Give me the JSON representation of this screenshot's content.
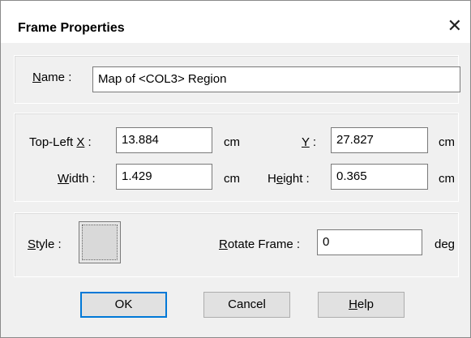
{
  "window": {
    "title": "Frame Properties",
    "close_icon": "close-icon"
  },
  "name_group": {
    "label_pre": "",
    "label_key": "N",
    "label_post": "ame :",
    "value": "Map of <COL3> Region"
  },
  "position_group": {
    "top_left_x": {
      "label_pre": "Top-Left ",
      "label_key": "X",
      "label_post": " :",
      "value": "13.884",
      "unit": "cm"
    },
    "y": {
      "label_pre": "",
      "label_key": "Y",
      "label_post": " :",
      "value": "27.827",
      "unit": "cm"
    },
    "width": {
      "label_pre": "",
      "label_key": "W",
      "label_post": "idth :",
      "value": "1.429",
      "unit": "cm"
    },
    "height": {
      "label_pre": "H",
      "label_key": "e",
      "label_post": "ight :",
      "value": "0.365",
      "unit": "cm"
    }
  },
  "style_group": {
    "style_label_key": "S",
    "style_label_post": "tyle :",
    "rotate_label_key": "R",
    "rotate_label_post": "otate Frame :",
    "rotate_value": "0",
    "rotate_unit": "deg"
  },
  "buttons": {
    "ok": "OK",
    "cancel": "Cancel",
    "help_key": "H",
    "help_post": "elp"
  }
}
